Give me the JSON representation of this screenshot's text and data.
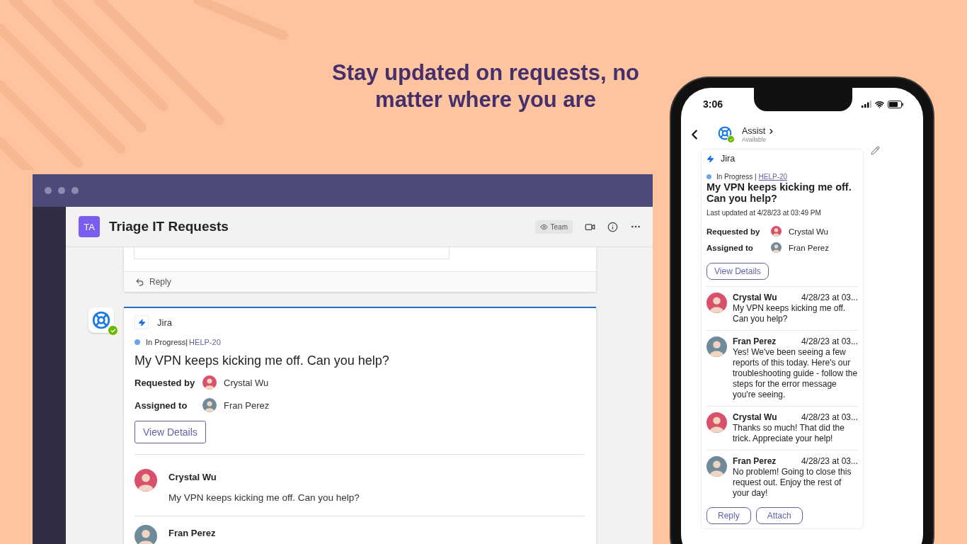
{
  "headline": "Stay updated on requests, no matter where you are",
  "desktop": {
    "channel_badge": "TA",
    "channel_title": "Triage IT Requests",
    "team_button": "Team",
    "previous_reply": "Reply",
    "card": {
      "app": "Jira",
      "status": "In Progress|",
      "ticket": "HELP-20",
      "title": "My VPN keeps kicking me off. Can you help?",
      "fields": [
        {
          "label": "Requested by",
          "value": "Crystal Wu"
        },
        {
          "label": "Assigned to",
          "value": "Fran Perez"
        }
      ],
      "button": "View Details",
      "messages": [
        {
          "author": "Crystal Wu",
          "text": "My VPN keeps kicking me off. Can you help?"
        },
        {
          "author": "Fran Perez"
        }
      ]
    }
  },
  "phone": {
    "time": "3:06",
    "bot_name": "Assist",
    "bot_status": "Available",
    "card": {
      "app": "Jira",
      "status": "In Progress |",
      "ticket": "HELP-20",
      "title": "My VPN keeps kicking me off. Can you help?",
      "updated": "Last updated at 4/28/23 at 03:49 PM",
      "fields": [
        {
          "label": "Requested by",
          "value": "Crystal Wu"
        },
        {
          "label": "Assigned to",
          "value": "Fran Perez"
        }
      ],
      "button": "View Details",
      "messages": [
        {
          "author": "Crystal Wu",
          "time": "4/28/23 at 03...",
          "text": "My VPN keeps kicking me off. Can you help?"
        },
        {
          "author": "Fran Perez",
          "time": "4/28/23 at 03...",
          "text": "Yes! We've been seeing a few reports of this today. Here's our troubleshooting guide - follow the steps for the error message you're seeing."
        },
        {
          "author": "Crystal Wu",
          "time": "4/28/23 at 03...",
          "text": "Thanks so much! That did the trick. Appreciate your help!"
        },
        {
          "author": "Fran Perez",
          "time": "4/28/23 at 03...",
          "text": "No problem! Going to close this request out. Enjoy the rest of your day!"
        }
      ],
      "actions": [
        "Reply",
        "Attach"
      ]
    }
  }
}
